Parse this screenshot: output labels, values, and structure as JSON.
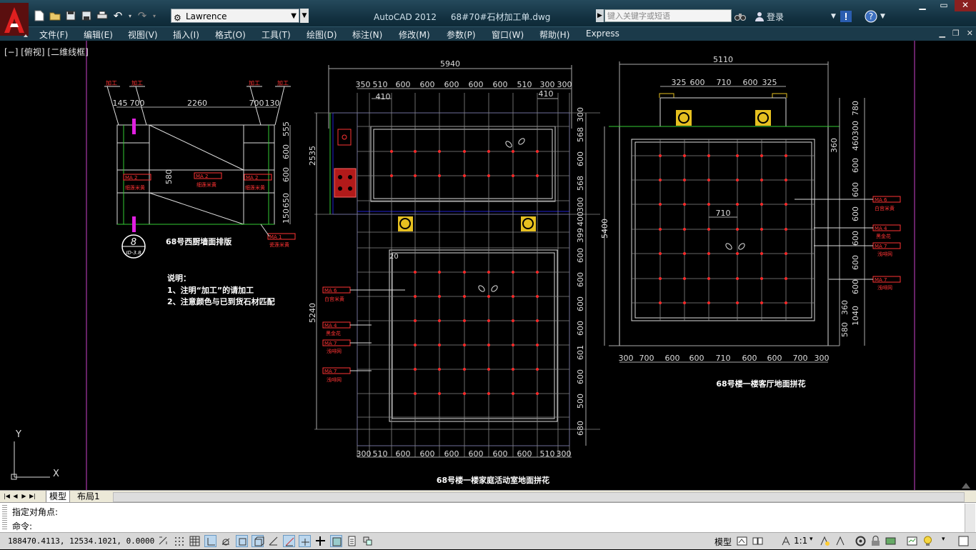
{
  "titlebar": {
    "app_name": "AutoCAD 2012",
    "file_name": "68#70#石材加工单.dwg",
    "workspace": "Lawrence",
    "search_placeholder": "键入关键字或短语",
    "login_label": "登录"
  },
  "menu": [
    "文件(F)",
    "编辑(E)",
    "视图(V)",
    "插入(I)",
    "格式(O)",
    "工具(T)",
    "绘图(D)",
    "标注(N)",
    "修改(M)",
    "参数(P)",
    "窗口(W)",
    "帮助(H)",
    "Express"
  ],
  "viewport_label": "[−] [俯视] [二维线框]",
  "drawing": {
    "left_panel": {
      "tags": [
        "加工",
        "加工",
        "加工",
        "加工"
      ],
      "dims_top": [
        "145",
        "700",
        "2260",
        "700",
        "130"
      ],
      "dims_right": [
        "555",
        "600",
        "600",
        "650",
        "150"
      ],
      "dim_580": "580",
      "label_codes": [
        "MA  2",
        "MA  2",
        "MA  2",
        "MA  1"
      ],
      "label_names": [
        "细莲米黄",
        "细莲米黄",
        "细莲米黄",
        "瓷莲米黄"
      ],
      "bubble_num": "8",
      "bubble_ref": "ID-3.8",
      "title": "68号西厨墙面排版",
      "notes_head": "说明：",
      "note1": "1、注明“加工”的请加工",
      "note2": "2、注意颜色与已到货石材匹配"
    },
    "middle_panel": {
      "dim_total": "5940",
      "dims_top": [
        "350",
        "510",
        "600",
        "600",
        "600",
        "600",
        "600",
        "510",
        "300"
      ],
      "dim_410a": "410",
      "dim_410b": "410",
      "dims_bottom": [
        "300",
        "510",
        "600",
        "600",
        "600",
        "600",
        "600",
        "510",
        "300"
      ],
      "dims_right": [
        "300",
        "568",
        "600",
        "600",
        "568",
        "300",
        "400",
        "399",
        "600",
        "600",
        "600",
        "600",
        "601",
        "600",
        "500",
        "680"
      ],
      "dim_left_upper": "2535",
      "dim_left_lower": "5240",
      "dim_20": "20",
      "label_codes": [
        "MA  6",
        "MA  4",
        "MA  7",
        "MA  7"
      ],
      "label_names": [
        "白宫米黄",
        "黑金花",
        "浅啡网",
        "浅啡网"
      ],
      "title": "68号楼一楼家庭活动室地面拼花"
    },
    "right_panel": {
      "dim_total": "5110",
      "dims_top": [
        "325",
        "600",
        "710",
        "600",
        "325"
      ],
      "dims_bottom": [
        "300",
        "700",
        "600",
        "600",
        "710",
        "600",
        "600",
        "700",
        "300"
      ],
      "dims_right": [
        "780",
        "300",
        "460",
        "600",
        "600",
        "600",
        "600",
        "600",
        "360",
        "1040",
        "580"
      ],
      "dim_5400": "5400",
      "dim_360": "360",
      "dim_710": "710",
      "label_codes": [
        "MA  6",
        "MA  4",
        "MA  7",
        "MA  7"
      ],
      "label_names": [
        "白宫米黄",
        "黑金花",
        "浅啡网",
        "浅啡网"
      ],
      "title": "68号楼一楼客厅地面拼花"
    },
    "ucs": {
      "x": "X",
      "y": "Y"
    }
  },
  "tabs": [
    "模型",
    "布局1"
  ],
  "command": {
    "history": "指定对角点:",
    "prompt": "命令:"
  },
  "status": {
    "coords": "188470.4113,  12534.1021,  0.0000",
    "model": "模型",
    "scale": "1:1"
  }
}
